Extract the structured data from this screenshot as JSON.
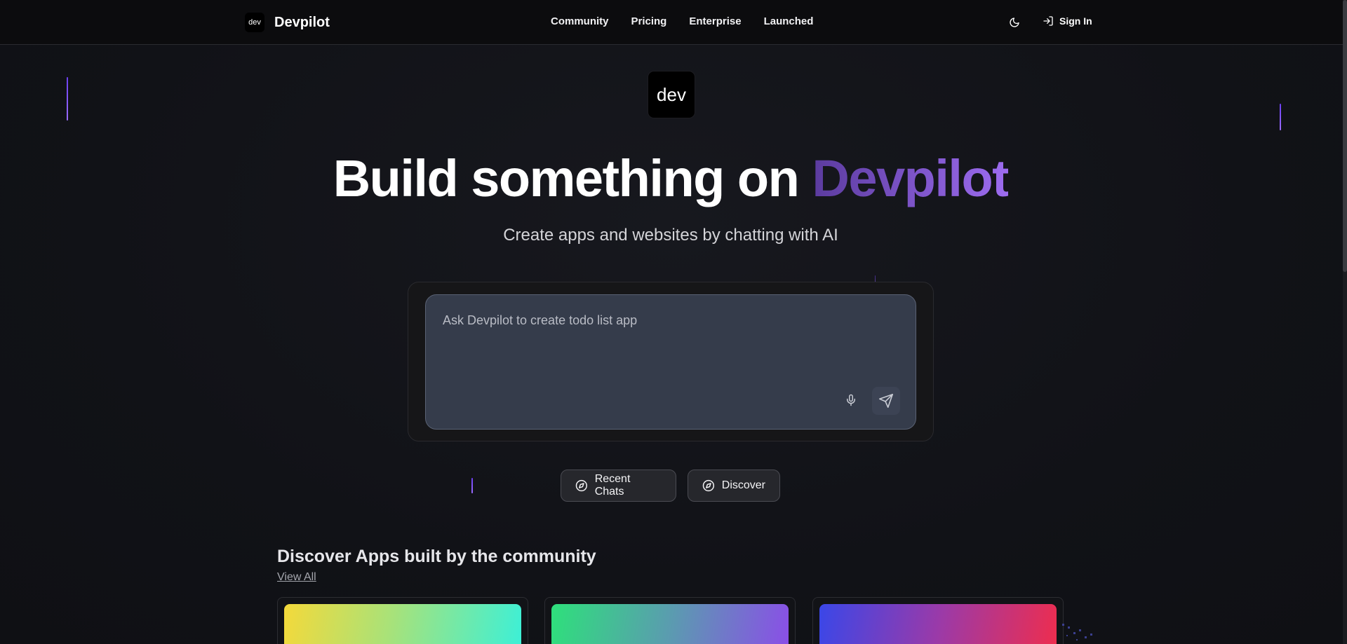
{
  "header": {
    "logo_text": "dev",
    "brand": "Devpilot",
    "nav": [
      "Community",
      "Pricing",
      "Enterprise",
      "Launched"
    ],
    "signin": "Sign In",
    "theme_icon": "moon-icon",
    "signin_icon": "log-in-icon"
  },
  "hero": {
    "logo_text": "dev",
    "title_main": "Build something on ",
    "title_accent": "Devpilot",
    "subtitle": "Create apps and websites by chatting with AI"
  },
  "prompt": {
    "placeholder": "Ask Devpilot to create todo list app",
    "mic_icon": "microphone-icon",
    "send_icon": "send-icon"
  },
  "actions": {
    "recent": "Recent Chats",
    "discover": "Discover",
    "icon": "compass-icon"
  },
  "community": {
    "title": "Discover Apps built by the community",
    "view_all": "View All"
  },
  "colors": {
    "accent_start": "#5b3b9e",
    "accent_end": "#9d6cf0",
    "background": "#111217"
  }
}
